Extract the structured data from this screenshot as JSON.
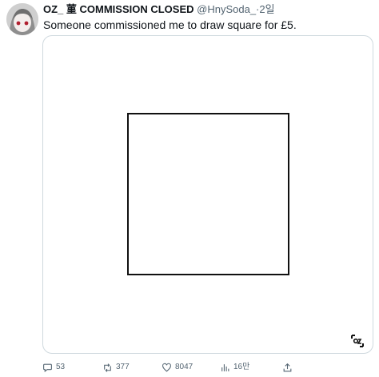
{
  "tweet": {
    "author_name": "OZ_ 菫 COMMISSION CLOSED",
    "handle": "@HnySoda_",
    "separator": "·",
    "time": "2일",
    "text": "Someone commissioned me to draw square for £5."
  },
  "actions": {
    "replies": "53",
    "retweets": "377",
    "likes": "8047",
    "views": "16만"
  },
  "icons": {
    "reply": "comment-icon",
    "retweet": "retweet-icon",
    "like": "heart-icon",
    "views": "bar-chart-icon",
    "share": "share-icon"
  },
  "colors": {
    "text": "#0f1419",
    "muted": "#536471",
    "border": "#cfd9de"
  }
}
